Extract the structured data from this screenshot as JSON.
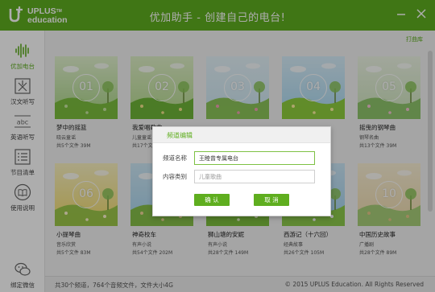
{
  "app": {
    "logo_text_line1": "UPLUS",
    "logo_tm": "TM",
    "logo_text_line2": "education",
    "title": "优加助手 - 创建自己的电台!"
  },
  "sidebar": {
    "items": [
      {
        "label": "优加电台",
        "icon": "radio-wave-icon"
      },
      {
        "label": "汉文听写",
        "icon": "chinese-character-icon"
      },
      {
        "label": "英语听写",
        "icon": "abc-icon"
      },
      {
        "label": "节目清单",
        "icon": "list-icon"
      },
      {
        "label": "使用说明",
        "icon": "book-icon"
      },
      {
        "label": "绑定微信",
        "icon": "wechat-icon"
      }
    ]
  },
  "main": {
    "favorites_link": "打曲库",
    "cards": [
      {
        "num": "01",
        "title": "梦中的摇篮",
        "sub": "晓云童谣",
        "meta": "共5个文件 39M",
        "theme": "green"
      },
      {
        "num": "02",
        "title": "我爱唱歌曲",
        "sub": "儿童童谣",
        "meta": "共17个文件",
        "theme": "spring"
      },
      {
        "num": "03",
        "title": "",
        "sub": "",
        "meta": "",
        "theme": "flowers"
      },
      {
        "num": "04",
        "title": "",
        "sub": "",
        "meta": "",
        "theme": "meadow"
      },
      {
        "num": "05",
        "title": "摇曳的钢琴曲",
        "sub": "钢琴名曲",
        "meta": "共13个文件 39M",
        "theme": "blossom"
      },
      {
        "num": "06",
        "title": "小提琴曲",
        "sub": "音乐欣赏",
        "meta": "共5个文件 83M",
        "theme": "yellow"
      },
      {
        "num": "",
        "title": "神奇校车",
        "sub": "有声小说",
        "meta": "共54个文件 202M",
        "theme": "road"
      },
      {
        "num": "",
        "title": "狮山塘的安妮",
        "sub": "有声小说",
        "meta": "共28个文件 149M",
        "theme": "hills"
      },
      {
        "num": "",
        "title": "西游记（十六回）",
        "sub": "经典故事",
        "meta": "共26个文件 105M",
        "theme": "sky"
      },
      {
        "num": "10",
        "title": "中国历史故事",
        "sub": "广播剧",
        "meta": "共28个文件 89M",
        "theme": "ferris"
      }
    ]
  },
  "status": {
    "left": "共30个频道，764个音频文件，文件大小4G",
    "right": "© 2015 UPLUS Education. All Rights Reserved"
  },
  "dialog": {
    "title": "频道编辑",
    "name_label": "频道名称",
    "name_value": "王睦曾专属电台",
    "type_label": "内容类别",
    "type_placeholder": "儿童歌曲",
    "confirm_label": "确 认",
    "cancel_label": "取 消"
  },
  "colors": {
    "brand": "#5fae1f",
    "statusbar": "#eeeeee"
  }
}
